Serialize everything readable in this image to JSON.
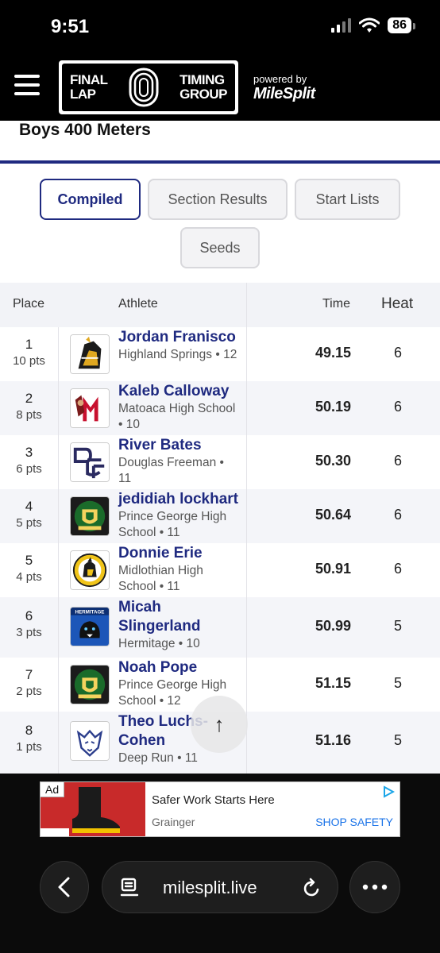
{
  "status_bar": {
    "time": "9:51",
    "battery": "86"
  },
  "header": {
    "brand_left": "FINAL\nLAP",
    "brand_right": "TIMING\nGROUP",
    "powered_by": "powered by",
    "partner": "MileSplit"
  },
  "event": {
    "title": "Boys 400 Meters"
  },
  "tabs": [
    {
      "label": "Compiled",
      "active": true
    },
    {
      "label": "Section Results",
      "active": false
    },
    {
      "label": "Start Lists",
      "active": false
    },
    {
      "label": "Seeds",
      "active": false
    }
  ],
  "table": {
    "headers": {
      "place": "Place",
      "athlete": "Athlete",
      "time": "Time",
      "heat": "Heat"
    },
    "rows": [
      {
        "place": "1",
        "pts": "10 pts",
        "name": "Jordan Franisco",
        "school": "Highland Springs • 12",
        "time": "49.15",
        "heat": "6",
        "logo": "warrior-logo-icon"
      },
      {
        "place": "2",
        "pts": "8 pts",
        "name": "Kaleb Calloway",
        "school": "Matoaca High School • 10",
        "time": "50.19",
        "heat": "6",
        "logo": "m-warrior-logo-icon"
      },
      {
        "place": "3",
        "pts": "6 pts",
        "name": "River Bates",
        "school": "Douglas Freeman • 11",
        "time": "50.30",
        "heat": "6",
        "logo": "dsf-logo-icon"
      },
      {
        "place": "4",
        "pts": "5 pts",
        "name": "jedidiah lockhart",
        "school": "Prince George High School • 11",
        "time": "50.64",
        "heat": "6",
        "logo": "prince-george-crest-icon"
      },
      {
        "place": "5",
        "pts": "4 pts",
        "name": "Donnie Erie",
        "school": "Midlothian High School • 11",
        "time": "50.91",
        "heat": "6",
        "logo": "trojan-logo-icon"
      },
      {
        "place": "6",
        "pts": "3 pts",
        "name": "Micah Slingerland",
        "school": "Hermitage • 10",
        "time": "50.99",
        "heat": "5",
        "logo": "panther-logo-icon",
        "logo_text": "HERMITAGE"
      },
      {
        "place": "7",
        "pts": "2 pts",
        "name": "Noah Pope",
        "school": "Prince George High School • 12",
        "time": "51.15",
        "heat": "5",
        "logo": "prince-george-crest-icon"
      },
      {
        "place": "8",
        "pts": "1 pts",
        "name": "Theo Luchs-Cohen",
        "school": "Deep Run • 11",
        "time": "51.16",
        "heat": "5",
        "logo": "wildcat-logo-icon"
      }
    ]
  },
  "ad": {
    "badge": "Ad",
    "headline": "Safer Work Starts Here",
    "advertiser": "Grainger",
    "cta": "SHOP SAFETY"
  },
  "browser": {
    "url": "milesplit.live"
  },
  "colors": {
    "primary": "#1f2a80",
    "ad_blue": "#1a73e8"
  }
}
